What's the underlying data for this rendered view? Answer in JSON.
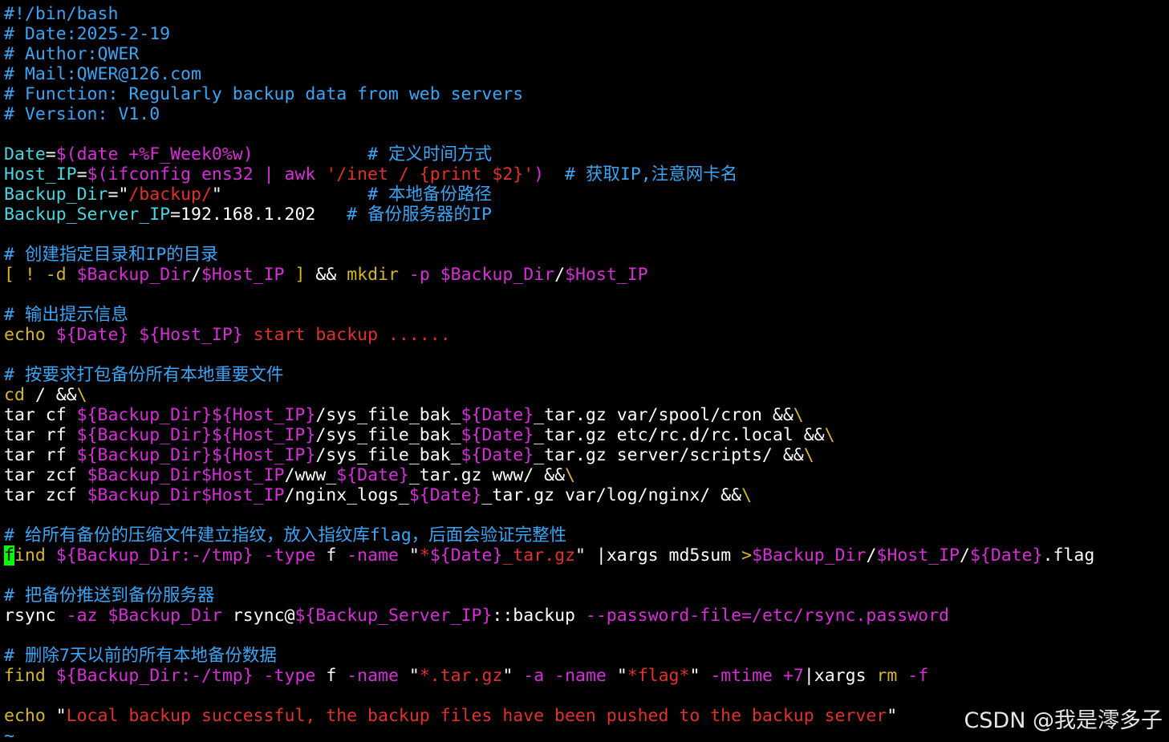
{
  "colors": {
    "comment": "#3ba5f5",
    "string": "#e0312f",
    "variable": "#d62fd6",
    "keyword": "#d4b62a",
    "identifier": "#49d6e0",
    "plain": "#ffffff",
    "cursor": "#00ff00",
    "tilde": "#3ba5f5"
  },
  "editor": {
    "lines": [
      [
        {
          "t": "#!/bin/bash",
          "c": "comment"
        }
      ],
      [
        {
          "t": "# Date:2025-2-19",
          "c": "comment"
        }
      ],
      [
        {
          "t": "# Author:QWER",
          "c": "comment"
        }
      ],
      [
        {
          "t": "# Mail:QWER@126.com",
          "c": "comment"
        }
      ],
      [
        {
          "t": "# Function: Regularly backup data from web servers",
          "c": "comment"
        }
      ],
      [
        {
          "t": "# Version: V1.0",
          "c": "comment"
        }
      ],
      [],
      [
        {
          "t": "Date",
          "c": "identifier"
        },
        {
          "t": "=",
          "c": "plain"
        },
        {
          "t": "$(date +%F_Week0%w)",
          "c": "variable"
        },
        {
          "t": "           ",
          "c": "plain"
        },
        {
          "t": "# 定义时间方式",
          "c": "comment"
        }
      ],
      [
        {
          "t": "Host_IP",
          "c": "identifier"
        },
        {
          "t": "=",
          "c": "plain"
        },
        {
          "t": "$(ifconfig ens32 | awk ",
          "c": "variable"
        },
        {
          "t": "'/inet / {print $2}'",
          "c": "string"
        },
        {
          "t": ")",
          "c": "variable"
        },
        {
          "t": "  ",
          "c": "plain"
        },
        {
          "t": "# 获取IP,注意网卡名",
          "c": "comment"
        }
      ],
      [
        {
          "t": "Backup_Dir",
          "c": "identifier"
        },
        {
          "t": "=",
          "c": "plain"
        },
        {
          "t": "\"",
          "c": "plain"
        },
        {
          "t": "/backup/",
          "c": "string"
        },
        {
          "t": "\"",
          "c": "plain"
        },
        {
          "t": "              ",
          "c": "plain"
        },
        {
          "t": "# 本地备份路径",
          "c": "comment"
        }
      ],
      [
        {
          "t": "Backup_Server_IP",
          "c": "identifier"
        },
        {
          "t": "=192.168.1.202   ",
          "c": "plain"
        },
        {
          "t": "# 备份服务器的IP",
          "c": "comment"
        }
      ],
      [],
      [
        {
          "t": "# 创建指定目录和IP的目录",
          "c": "comment"
        }
      ],
      [
        {
          "t": "[ ! -d ",
          "c": "keyword"
        },
        {
          "t": "$Backup_Dir",
          "c": "variable"
        },
        {
          "t": "/",
          "c": "plain"
        },
        {
          "t": "$Host_IP",
          "c": "variable"
        },
        {
          "t": " ]",
          "c": "keyword"
        },
        {
          "t": " && ",
          "c": "plain"
        },
        {
          "t": "mkdir",
          "c": "keyword"
        },
        {
          "t": " ",
          "c": "plain"
        },
        {
          "t": "-p",
          "c": "variable"
        },
        {
          "t": " ",
          "c": "plain"
        },
        {
          "t": "$Backup_Dir",
          "c": "variable"
        },
        {
          "t": "/",
          "c": "plain"
        },
        {
          "t": "$Host_IP",
          "c": "variable"
        }
      ],
      [],
      [
        {
          "t": "# 输出提示信息",
          "c": "comment"
        }
      ],
      [
        {
          "t": "echo",
          "c": "keyword"
        },
        {
          "t": " ",
          "c": "plain"
        },
        {
          "t": "${Date}",
          "c": "variable"
        },
        {
          "t": " ",
          "c": "plain"
        },
        {
          "t": "${Host_IP}",
          "c": "variable"
        },
        {
          "t": " start backup ......",
          "c": "string"
        }
      ],
      [],
      [
        {
          "t": "# 按要求打包备份所有本地重要文件",
          "c": "comment"
        }
      ],
      [
        {
          "t": "cd",
          "c": "keyword"
        },
        {
          "t": " / &&",
          "c": "plain"
        },
        {
          "t": "\\",
          "c": "keyword"
        }
      ],
      [
        {
          "t": "tar cf ",
          "c": "plain"
        },
        {
          "t": "${Backup_Dir}${Host_IP}",
          "c": "variable"
        },
        {
          "t": "/sys_file_bak_",
          "c": "plain"
        },
        {
          "t": "${Date}",
          "c": "variable"
        },
        {
          "t": "_tar.gz var/spool/cron &&",
          "c": "plain"
        },
        {
          "t": "\\",
          "c": "keyword"
        }
      ],
      [
        {
          "t": "tar rf ",
          "c": "plain"
        },
        {
          "t": "${Backup_Dir}${Host_IP}",
          "c": "variable"
        },
        {
          "t": "/sys_file_bak_",
          "c": "plain"
        },
        {
          "t": "${Date}",
          "c": "variable"
        },
        {
          "t": "_tar.gz etc/rc.d/rc.local &&",
          "c": "plain"
        },
        {
          "t": "\\",
          "c": "keyword"
        }
      ],
      [
        {
          "t": "tar rf ",
          "c": "plain"
        },
        {
          "t": "${Backup_Dir}${Host_IP}",
          "c": "variable"
        },
        {
          "t": "/sys_file_bak_",
          "c": "plain"
        },
        {
          "t": "${Date}",
          "c": "variable"
        },
        {
          "t": "_tar.gz server/scripts/ &&",
          "c": "plain"
        },
        {
          "t": "\\",
          "c": "keyword"
        }
      ],
      [
        {
          "t": "tar zcf ",
          "c": "plain"
        },
        {
          "t": "$Backup_Dir$Host_IP",
          "c": "variable"
        },
        {
          "t": "/www_",
          "c": "plain"
        },
        {
          "t": "${Date}",
          "c": "variable"
        },
        {
          "t": "_tar.gz www/ &&",
          "c": "plain"
        },
        {
          "t": "\\",
          "c": "keyword"
        }
      ],
      [
        {
          "t": "tar zcf ",
          "c": "plain"
        },
        {
          "t": "$Backup_Dir$Host_IP",
          "c": "variable"
        },
        {
          "t": "/nginx_logs_",
          "c": "plain"
        },
        {
          "t": "${Date}",
          "c": "variable"
        },
        {
          "t": "_tar.gz var/log/nginx/ &&",
          "c": "plain"
        },
        {
          "t": "\\",
          "c": "keyword"
        }
      ],
      [],
      [
        {
          "t": "# 给所有备份的压缩文件建立指纹，放入指纹库flag，后面会验证完整性",
          "c": "comment"
        }
      ],
      [
        {
          "t": "f",
          "c": "cursor"
        },
        {
          "t": "ind",
          "c": "keyword"
        },
        {
          "t": " ",
          "c": "plain"
        },
        {
          "t": "${Backup_Dir:-/tmp}",
          "c": "variable"
        },
        {
          "t": " ",
          "c": "plain"
        },
        {
          "t": "-type",
          "c": "variable"
        },
        {
          "t": " f ",
          "c": "plain"
        },
        {
          "t": "-name",
          "c": "variable"
        },
        {
          "t": " \"",
          "c": "plain"
        },
        {
          "t": "*",
          "c": "string"
        },
        {
          "t": "${Date}",
          "c": "variable"
        },
        {
          "t": "_tar.gz",
          "c": "string"
        },
        {
          "t": "\" |xargs md5sum ",
          "c": "plain"
        },
        {
          "t": ">",
          "c": "keyword"
        },
        {
          "t": "$Backup_Dir",
          "c": "variable"
        },
        {
          "t": "/",
          "c": "plain"
        },
        {
          "t": "$Host_IP",
          "c": "variable"
        },
        {
          "t": "/",
          "c": "plain"
        },
        {
          "t": "${Date}",
          "c": "variable"
        },
        {
          "t": ".flag",
          "c": "plain"
        }
      ],
      [],
      [
        {
          "t": "# 把备份推送到备份服务器",
          "c": "comment"
        }
      ],
      [
        {
          "t": "rsync ",
          "c": "plain"
        },
        {
          "t": "-az",
          "c": "variable"
        },
        {
          "t": " ",
          "c": "plain"
        },
        {
          "t": "$Backup_Dir",
          "c": "variable"
        },
        {
          "t": " rsync@",
          "c": "plain"
        },
        {
          "t": "${Backup_Server_IP}",
          "c": "variable"
        },
        {
          "t": "::backup ",
          "c": "plain"
        },
        {
          "t": "--password-file=/etc/rsync.password",
          "c": "variable"
        }
      ],
      [],
      [
        {
          "t": "# 删除7天以前的所有本地备份数据",
          "c": "comment"
        }
      ],
      [
        {
          "t": "find",
          "c": "keyword"
        },
        {
          "t": " ",
          "c": "plain"
        },
        {
          "t": "${Backup_Dir:-/tmp}",
          "c": "variable"
        },
        {
          "t": " ",
          "c": "plain"
        },
        {
          "t": "-type",
          "c": "variable"
        },
        {
          "t": " f ",
          "c": "plain"
        },
        {
          "t": "-name",
          "c": "variable"
        },
        {
          "t": " \"",
          "c": "plain"
        },
        {
          "t": "*.tar.gz",
          "c": "string"
        },
        {
          "t": "\" ",
          "c": "plain"
        },
        {
          "t": "-a",
          "c": "variable"
        },
        {
          "t": " ",
          "c": "plain"
        },
        {
          "t": "-name",
          "c": "variable"
        },
        {
          "t": " \"",
          "c": "plain"
        },
        {
          "t": "*flag*",
          "c": "string"
        },
        {
          "t": "\" ",
          "c": "plain"
        },
        {
          "t": "-mtime",
          "c": "variable"
        },
        {
          "t": " ",
          "c": "plain"
        },
        {
          "t": "+7",
          "c": "variable"
        },
        {
          "t": "|xargs ",
          "c": "plain"
        },
        {
          "t": "rm",
          "c": "keyword"
        },
        {
          "t": " ",
          "c": "plain"
        },
        {
          "t": "-f",
          "c": "variable"
        }
      ],
      [],
      [
        {
          "t": "echo",
          "c": "keyword"
        },
        {
          "t": " \"",
          "c": "plain"
        },
        {
          "t": "Local backup successful, the backup files have been pushed to the backup server",
          "c": "string"
        },
        {
          "t": "\"",
          "c": "plain"
        }
      ],
      [
        {
          "t": "~",
          "c": "tilde"
        }
      ]
    ]
  },
  "watermark": {
    "text": "CSDN @我是澪多子"
  }
}
